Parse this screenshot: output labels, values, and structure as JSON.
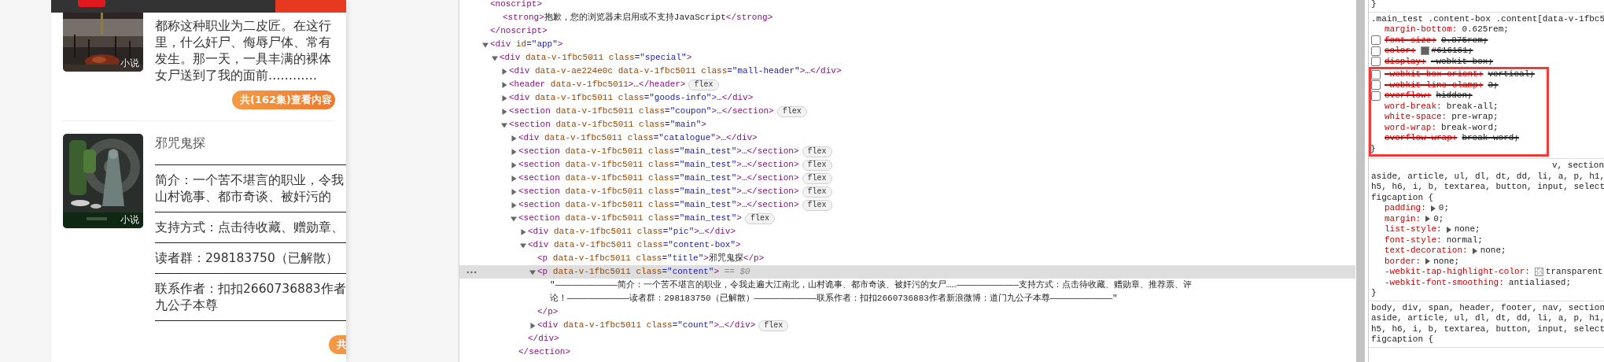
{
  "preview": {
    "books": [
      {
        "kind": "plain",
        "cover": {
          "kind": "picture",
          "badge": "小说"
        },
        "lines": [
          "都称这种职业为二皮匠。在这行",
          "里，什么奸尸、侮辱尸体、常有",
          "发生。那一天，一具丰满的裸体",
          "女尸送到了我的面前…………"
        ],
        "button": "共(162集)查看内容"
      },
      {
        "kind": "ruled",
        "cover": {
          "kind": "picture",
          "badge": "小说"
        },
        "title": "邪咒鬼探",
        "sections": [
          [
            "简介：一个苦不堪言的职业，令我",
            "山村诡事、都市奇谈、被奸污的"
          ],
          [
            "支持方式：点击待收藏、赠勋章、"
          ],
          [
            "读者群：298183750（已解散）"
          ],
          [
            "联系作者：扣扣2660736883作者",
            "九公子本尊"
          ]
        ],
        "button": "共"
      }
    ]
  },
  "elements": {
    "tree": [
      {
        "line": [
          {
            "kind": "tag",
            "text": "<noscript>"
          }
        ],
        "selected": false,
        "children": [
          {
            "kind": "text",
            "line": [
              {
                "kind": "tag",
                "text": "<strong>"
              },
              {
                "kind": "text",
                "text": "抱歉，您的浏览器未启用或不支持JavaScript"
              },
              {
                "kind": "tag",
                "text": "</strong>"
              }
            ],
            "selected": false
          }
        ],
        "end": [
          {
            "kind": "tag",
            "text": "</noscript>"
          }
        ]
      },
      {
        "line": [
          {
            "kind": "tag",
            "text": "<div"
          },
          {
            "kind": "attr",
            "text": " id"
          },
          {
            "kind": "value",
            "text": "=\"app\""
          },
          {
            "kind": "tag",
            "text": ">"
          }
        ],
        "expanded": true,
        "selected": false,
        "children": [
          {
            "line": [
              {
                "kind": "tag",
                "text": "<div"
              },
              {
                "kind": "attr",
                "text": " data-v-1fbc5011"
              },
              {
                "kind": "attr",
                "text": " class"
              },
              {
                "kind": "value",
                "text": "=\"special\""
              },
              {
                "kind": "tag",
                "text": ">"
              }
            ],
            "expanded": true,
            "selected": false,
            "children": [
              {
                "line": [
                  {
                    "kind": "tag",
                    "text": "<div"
                  },
                  {
                    "kind": "attr",
                    "text": " data-v-ae224e0c"
                  },
                  {
                    "kind": "attr",
                    "text": " data-v-1fbc5011"
                  },
                  {
                    "kind": "attr",
                    "text": " class"
                  },
                  {
                    "kind": "value",
                    "text": "=\"mall-header\""
                  },
                  {
                    "kind": "tag",
                    "text": ">"
                  },
                  {
                    "kind": "text",
                    "text": "…"
                  },
                  {
                    "kind": "tag",
                    "text": "</div>"
                  }
                ],
                "expanded": false,
                "selected": false
              },
              {
                "line": [
                  {
                    "kind": "tag",
                    "text": "<header"
                  },
                  {
                    "kind": "attr",
                    "text": " data-v-1fbc5011"
                  },
                  {
                    "kind": "tag",
                    "text": ">"
                  },
                  {
                    "kind": "text",
                    "text": "…"
                  },
                  {
                    "kind": "tag",
                    "text": "</header>"
                  }
                ],
                "expanded": false,
                "selected": false,
                "badge": "flex"
              },
              {
                "line": [
                  {
                    "kind": "tag",
                    "text": "<div"
                  },
                  {
                    "kind": "attr",
                    "text": " data-v-1fbc5011"
                  },
                  {
                    "kind": "attr",
                    "text": " class"
                  },
                  {
                    "kind": "value",
                    "text": "=\"goods-info\""
                  },
                  {
                    "kind": "tag",
                    "text": ">"
                  },
                  {
                    "kind": "text",
                    "text": "…"
                  },
                  {
                    "kind": "tag",
                    "text": "</div>"
                  }
                ],
                "expanded": false,
                "selected": false
              },
              {
                "line": [
                  {
                    "kind": "tag",
                    "text": "<section"
                  },
                  {
                    "kind": "attr",
                    "text": " data-v-1fbc5011"
                  },
                  {
                    "kind": "attr",
                    "text": " class"
                  },
                  {
                    "kind": "value",
                    "text": "=\"coupon\""
                  },
                  {
                    "kind": "tag",
                    "text": ">"
                  },
                  {
                    "kind": "text",
                    "text": "…"
                  },
                  {
                    "kind": "tag",
                    "text": "</section>"
                  }
                ],
                "expanded": false,
                "selected": false,
                "badge": "flex"
              },
              {
                "line": [
                  {
                    "kind": "tag",
                    "text": "<section"
                  },
                  {
                    "kind": "attr",
                    "text": " data-v-1fbc5011"
                  },
                  {
                    "kind": "attr",
                    "text": " class"
                  },
                  {
                    "kind": "value",
                    "text": "=\"main\""
                  },
                  {
                    "kind": "tag",
                    "text": ">"
                  }
                ],
                "expanded": true,
                "selected": false,
                "children": [
                  {
                    "line": [
                      {
                        "kind": "tag",
                        "text": "<div"
                      },
                      {
                        "kind": "attr",
                        "text": " data-v-1fbc5011"
                      },
                      {
                        "kind": "attr",
                        "text": " class"
                      },
                      {
                        "kind": "value",
                        "text": "=\"catalogue\""
                      },
                      {
                        "kind": "tag",
                        "text": ">"
                      },
                      {
                        "kind": "text",
                        "text": "…"
                      },
                      {
                        "kind": "tag",
                        "text": "</div>"
                      }
                    ],
                    "expanded": false,
                    "selected": false
                  },
                  {
                    "line": [
                      {
                        "kind": "tag",
                        "text": "<section"
                      },
                      {
                        "kind": "attr",
                        "text": " data-v-1fbc5011"
                      },
                      {
                        "kind": "attr",
                        "text": " class"
                      },
                      {
                        "kind": "value",
                        "text": "=\"main_test\""
                      },
                      {
                        "kind": "tag",
                        "text": ">"
                      },
                      {
                        "kind": "text",
                        "text": "…"
                      },
                      {
                        "kind": "tag",
                        "text": "</section>"
                      }
                    ],
                    "expanded": false,
                    "selected": false,
                    "badge": "flex"
                  },
                  {
                    "line": [
                      {
                        "kind": "tag",
                        "text": "<section"
                      },
                      {
                        "kind": "attr",
                        "text": " data-v-1fbc5011"
                      },
                      {
                        "kind": "attr",
                        "text": " class"
                      },
                      {
                        "kind": "value",
                        "text": "=\"main_test\""
                      },
                      {
                        "kind": "tag",
                        "text": ">"
                      },
                      {
                        "kind": "text",
                        "text": "…"
                      },
                      {
                        "kind": "tag",
                        "text": "</section>"
                      }
                    ],
                    "expanded": false,
                    "selected": false,
                    "badge": "flex"
                  },
                  {
                    "line": [
                      {
                        "kind": "tag",
                        "text": "<section"
                      },
                      {
                        "kind": "attr",
                        "text": " data-v-1fbc5011"
                      },
                      {
                        "kind": "attr",
                        "text": " class"
                      },
                      {
                        "kind": "value",
                        "text": "=\"main_test\""
                      },
                      {
                        "kind": "tag",
                        "text": ">"
                      },
                      {
                        "kind": "text",
                        "text": "…"
                      },
                      {
                        "kind": "tag",
                        "text": "</section>"
                      }
                    ],
                    "expanded": false,
                    "selected": false,
                    "badge": "flex"
                  },
                  {
                    "line": [
                      {
                        "kind": "tag",
                        "text": "<section"
                      },
                      {
                        "kind": "attr",
                        "text": " data-v-1fbc5011"
                      },
                      {
                        "kind": "attr",
                        "text": " class"
                      },
                      {
                        "kind": "value",
                        "text": "=\"main_test\""
                      },
                      {
                        "kind": "tag",
                        "text": ">"
                      },
                      {
                        "kind": "text",
                        "text": "…"
                      },
                      {
                        "kind": "tag",
                        "text": "</section>"
                      }
                    ],
                    "expanded": false,
                    "selected": false,
                    "badge": "flex"
                  },
                  {
                    "line": [
                      {
                        "kind": "tag",
                        "text": "<section"
                      },
                      {
                        "kind": "attr",
                        "text": " data-v-1fbc5011"
                      },
                      {
                        "kind": "attr",
                        "text": " class"
                      },
                      {
                        "kind": "value",
                        "text": "=\"main_test\""
                      },
                      {
                        "kind": "tag",
                        "text": ">"
                      },
                      {
                        "kind": "text",
                        "text": "…"
                      },
                      {
                        "kind": "tag",
                        "text": "</section>"
                      }
                    ],
                    "expanded": false,
                    "selected": false,
                    "badge": "flex"
                  },
                  {
                    "line": [
                      {
                        "kind": "tag",
                        "text": "<section"
                      },
                      {
                        "kind": "attr",
                        "text": " data-v-1fbc5011"
                      },
                      {
                        "kind": "attr",
                        "text": " class"
                      },
                      {
                        "kind": "value",
                        "text": "=\"main_test\""
                      },
                      {
                        "kind": "tag",
                        "text": ">"
                      }
                    ],
                    "expanded": true,
                    "selected": false,
                    "badge": "flex",
                    "children": [
                      {
                        "line": [
                          {
                            "kind": "tag",
                            "text": "<div"
                          },
                          {
                            "kind": "attr",
                            "text": " data-v-1fbc5011"
                          },
                          {
                            "kind": "attr",
                            "text": " class"
                          },
                          {
                            "kind": "value",
                            "text": "=\"pic\""
                          },
                          {
                            "kind": "tag",
                            "text": ">"
                          },
                          {
                            "kind": "text",
                            "text": "…"
                          },
                          {
                            "kind": "tag",
                            "text": "</div>"
                          }
                        ],
                        "expanded": false,
                        "selected": false
                      },
                      {
                        "line": [
                          {
                            "kind": "tag",
                            "text": "<div"
                          },
                          {
                            "kind": "attr",
                            "text": " data-v-1fbc5011"
                          },
                          {
                            "kind": "attr",
                            "text": " class"
                          },
                          {
                            "kind": "value",
                            "text": "=\"content-box\""
                          },
                          {
                            "kind": "tag",
                            "text": ">"
                          }
                        ],
                        "expanded": true,
                        "selected": false,
                        "children": [
                          {
                            "line": [
                              {
                                "kind": "tag",
                                "text": "<p"
                              },
                              {
                                "kind": "attr",
                                "text": " data-v-1fbc5011"
                              },
                              {
                                "kind": "attr",
                                "text": " class"
                              },
                              {
                                "kind": "value",
                                "text": "=\"title\""
                              },
                              {
                                "kind": "tag",
                                "text": ">"
                              },
                              {
                                "kind": "text",
                                "text": "邪咒鬼探"
                              },
                              {
                                "kind": "tag",
                                "text": "</p>"
                              }
                            ],
                            "selected": false
                          },
                          {
                            "line": [
                              {
                                "kind": "tag",
                                "text": "<p"
                              },
                              {
                                "kind": "attr",
                                "text": " data-v-1fbc5011"
                              },
                              {
                                "kind": "attr",
                                "text": " class"
                              },
                              {
                                "kind": "value",
                                "text": "=\"content\""
                              },
                              {
                                "kind": "tag",
                                "text": ">"
                              },
                              {
                                "kind": "hint",
                                "text": " == $0"
                              }
                            ],
                            "expanded": true,
                            "selected": true,
                            "children": [
                              {
                                "kind": "text",
                                "lines": [
                                  "\"————————————简介：一个苦不堪言的职业，令我走遍大江南北，山村诡事、都市奇谈、被奸污的女尸……————————————支持方式：点击待收藏、赠勋章、推荐票、评",
                                  "论！————————————读者群：298183750（已解散）————————————联系作者：扣扣2660736883作者新浪微博：道门九公子本尊————————————\""
                                ],
                                "selected": false
                              }
                            ],
                            "end": [
                              {
                                "kind": "tag",
                                "text": "</p>"
                              }
                            ]
                          },
                          {
                            "line": [
                              {
                                "kind": "tag",
                                "text": "<div"
                              },
                              {
                                "kind": "attr",
                                "text": " data-v-1fbc5011"
                              },
                              {
                                "kind": "attr",
                                "text": " class"
                              },
                              {
                                "kind": "value",
                                "text": "=\"count\""
                              },
                              {
                                "kind": "tag",
                                "text": ">"
                              },
                              {
                                "kind": "text",
                                "text": "…"
                              },
                              {
                                "kind": "tag",
                                "text": "</div>"
                              }
                            ],
                            "expanded": false,
                            "selected": false,
                            "badge": "flex"
                          }
                        ],
                        "end": [
                          {
                            "kind": "tag",
                            "text": "</div>"
                          }
                        ]
                      }
                    ],
                    "end": [
                      {
                        "kind": "tag",
                        "text": "</section>"
                      }
                    ]
                  }
                ]
              }
            ]
          }
        ]
      }
    ]
  },
  "styles": {
    "rules": [
      {
        "close": "}"
      },
      {
        "selector": [
          ".main_test .content-box .content[data-v-1fbc5"
        ],
        "properties": [
          {
            "name": "margin-bottom:",
            "value": "0.625rem;",
            "disabled": false,
            "overridden": false
          },
          {
            "name": "font-size:",
            "value": "0.875rem;",
            "disabled": true,
            "overridden": false
          },
          {
            "name": "color:",
            "value": "#616161;",
            "disabled": true,
            "overridden": false,
            "color": "#616161"
          },
          {
            "name": "display:",
            "value": "-webkit-box;",
            "disabled": true,
            "overridden": false
          }
        ],
        "highlighted_properties": [
          {
            "name": "-webkit-box-orient:",
            "value": "vertical;",
            "disabled": true,
            "overridden": false
          },
          {
            "name": "-webkit-line-clamp:",
            "value": "3;",
            "disabled": true,
            "overridden": false
          },
          {
            "name": "overflow:",
            "value": "hidden;",
            "disabled": true,
            "overridden": false
          },
          {
            "name": "word-break:",
            "value": "break-all;",
            "disabled": false,
            "overridden": false
          },
          {
            "name": "white-space:",
            "value": "pre-wrap;",
            "disabled": false,
            "overridden": false
          },
          {
            "name": "word-wrap:",
            "value": "break-word;",
            "disabled": false,
            "overridden": false
          },
          {
            "name": "overflow-wrap:",
            "value": "break-word;",
            "disabled": false,
            "overridden": true
          }
        ],
        "close": "}"
      },
      {
        "cut_selector_line": "v, section",
        "selector": [
          "aside, article, ul, dl, dt, dd, li, a, p, h1,",
          "h5, h6, i, b, textarea, button, input, select",
          "figcaption {"
        ],
        "properties": [
          {
            "name": "padding:",
            "value": "0;",
            "disabled": false,
            "overridden": false,
            "expandable": true
          },
          {
            "name": "margin:",
            "value": "0;",
            "disabled": false,
            "overridden": false,
            "expandable": true
          },
          {
            "name": "list-style:",
            "value": "none;",
            "disabled": false,
            "overridden": false,
            "expandable": true
          },
          {
            "name": "font-style:",
            "value": "normal;",
            "disabled": false,
            "overridden": false,
            "expandable": false
          },
          {
            "name": "text-decoration:",
            "value": "none;",
            "disabled": false,
            "overridden": false,
            "expandable": true
          },
          {
            "name": "border:",
            "value": "none;",
            "disabled": false,
            "overridden": false,
            "expandable": true
          },
          {
            "name": "-webkit-tap-highlight-color:",
            "value": "transparent",
            "disabled": false,
            "overridden": false,
            "expandable": false,
            "transparent_swatch": true
          },
          {
            "name": "-webkit-font-smoothing:",
            "value": "antialiased;",
            "disabled": false,
            "overridden": false,
            "expandable": false
          }
        ],
        "close": "}"
      },
      {
        "selector": [
          "body, div, span, header, footer, nav, section",
          "aside, article, ul, dl, dt, dd, li, a, p, h1,",
          "h5, h6, i, b, textarea, button, input, select",
          "figcaption {"
        ]
      }
    ]
  }
}
